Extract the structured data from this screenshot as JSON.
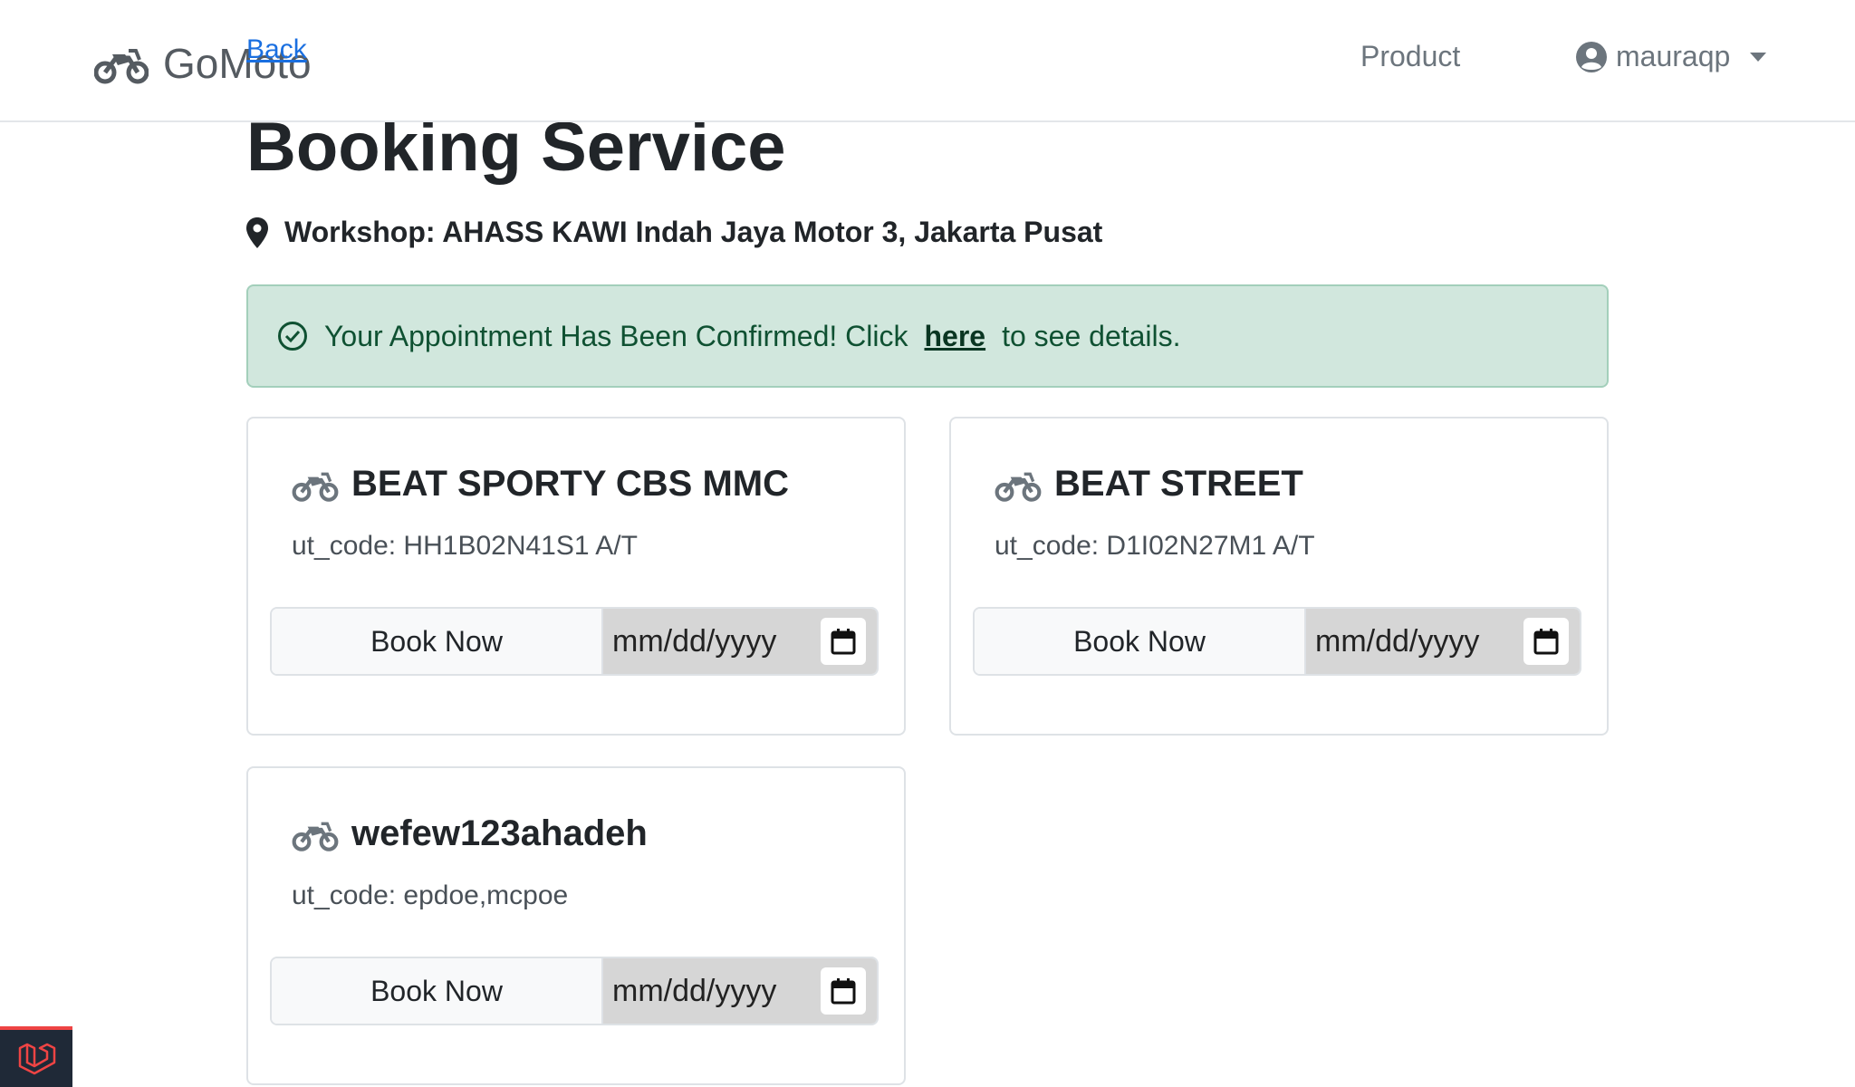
{
  "navbar": {
    "brand": "GoMoto",
    "back_link": "Back",
    "product_link": "Product",
    "user_name": "mauraqp"
  },
  "page": {
    "title": "Booking Service",
    "workshop": "Workshop: AHASS KAWI Indah Jaya Motor 3, Jakarta Pusat"
  },
  "alert": {
    "text_before": "Your Appointment Has Been Confirmed! Click",
    "link": "here",
    "text_after": "to see details."
  },
  "cards": [
    {
      "name": "BEAT SPORTY CBS MMC",
      "code": "ut_code: HH1B02N41S1 A/T",
      "button": "Book Now",
      "date_placeholder": "mm/dd/yyyy"
    },
    {
      "name": "BEAT STREET",
      "code": "ut_code: D1I02N27M1 A/T",
      "button": "Book Now",
      "date_placeholder": "mm/dd/yyyy"
    },
    {
      "name": "wefew123ahadeh",
      "code": "ut_code: epdoe,mcpoe",
      "button": "Book Now",
      "date_placeholder": "mm/dd/yyyy"
    }
  ],
  "colors": {
    "alert_bg": "#d1e7dd",
    "alert_text": "#0f5132",
    "link_blue": "#1a6fe0"
  },
  "icons": [
    "motorcycle-icon",
    "user-circle-icon",
    "map-pin-icon",
    "check-circle-icon",
    "calendar-icon",
    "laravel-icon"
  ]
}
